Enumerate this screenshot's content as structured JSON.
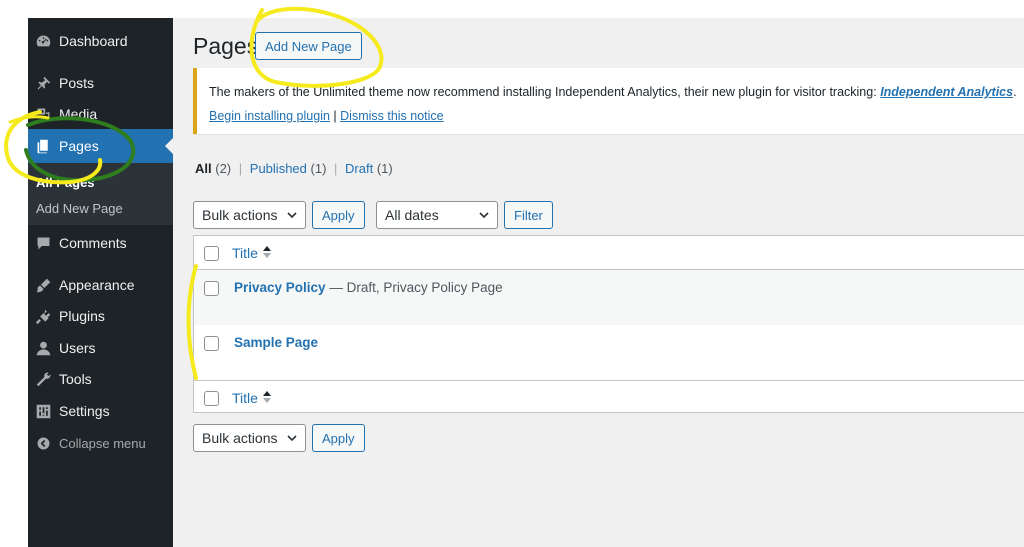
{
  "sidebar": {
    "items": [
      {
        "label": "Dashboard",
        "icon": "dashboard-icon"
      },
      {
        "label": "Posts",
        "icon": "pin-icon"
      },
      {
        "label": "Media",
        "icon": "media-icon"
      },
      {
        "label": "Pages",
        "icon": "pages-icon"
      },
      {
        "label": "Comments",
        "icon": "comment-icon"
      },
      {
        "label": "Appearance",
        "icon": "brush-icon"
      },
      {
        "label": "Plugins",
        "icon": "plugin-icon"
      },
      {
        "label": "Users",
        "icon": "user-icon"
      },
      {
        "label": "Tools",
        "icon": "wrench-icon"
      },
      {
        "label": "Settings",
        "icon": "settings-icon"
      }
    ],
    "submenu": {
      "all_pages": "All Pages",
      "add_new_page": "Add New Page"
    },
    "collapse_label": "Collapse menu"
  },
  "header": {
    "title": "Pages",
    "add_new_label": "Add New Page"
  },
  "notice": {
    "text": "The makers of the Unlimited theme now recommend installing Independent Analytics, their new plugin for visitor tracking:",
    "link": "Independent Analytics",
    "trailing": ".",
    "install_label": "Begin installing plugin",
    "separator": "|",
    "dismiss_label": "Dismiss this notice"
  },
  "filters": {
    "all": {
      "label": "All",
      "count": "(2)"
    },
    "published": {
      "label": "Published",
      "count": "(1)"
    },
    "draft": {
      "label": "Draft",
      "count": "(1)"
    },
    "sep": "|"
  },
  "toolbar": {
    "bulk_actions": "Bulk actions",
    "apply": "Apply",
    "all_dates": "All dates",
    "filter": "Filter"
  },
  "table": {
    "column_title": "Title",
    "rows": [
      {
        "title": "Privacy Policy",
        "state": "— Draft, Privacy Policy Page"
      },
      {
        "title": "Sample Page",
        "state": ""
      }
    ]
  },
  "annotation_color": "#f5ea1b",
  "annotation_color_green": "#2e7d1e",
  "active_color": "#2271b1"
}
